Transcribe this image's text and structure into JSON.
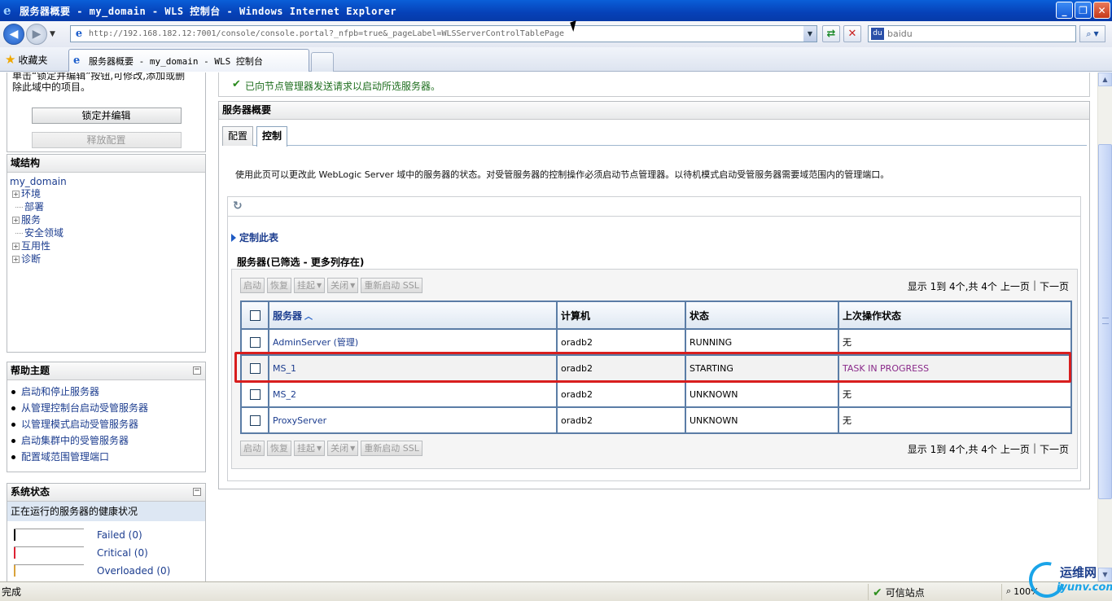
{
  "window": {
    "title": "服务器概要 - my_domain - WLS 控制台 - Windows Internet Explorer"
  },
  "address_bar": {
    "url": "http://192.168.182.12:7001/console/console.portal?_nfpb=true&_pageLabel=WLSServerControlTablePage"
  },
  "search": {
    "placeholder": "baidu"
  },
  "favorites": {
    "label": "收藏夹"
  },
  "tab": {
    "label": "服务器概要 - my_domain - WLS 控制台"
  },
  "change_center": {
    "text_line1": "单击“锁定并编辑”按钮,可修改,添加或删",
    "text_line2": "除此域中的项目。",
    "lock_button": "锁定并编辑",
    "release_button": "释放配置"
  },
  "domain_structure": {
    "title": "域结构",
    "root": "my_domain",
    "nodes": [
      {
        "label": "环境",
        "expandable": true
      },
      {
        "label": "部署",
        "expandable": false
      },
      {
        "label": "服务",
        "expandable": true
      },
      {
        "label": "安全领域",
        "expandable": false
      },
      {
        "label": "互用性",
        "expandable": true
      },
      {
        "label": "诊断",
        "expandable": true
      }
    ]
  },
  "help": {
    "title": "帮助主题",
    "items": [
      "启动和停止服务器",
      "从管理控制台启动受管服务器",
      "以管理模式启动受管服务器",
      "启动集群中的受管服务器",
      "配置域范围管理端口"
    ]
  },
  "system_status": {
    "title": "系统状态",
    "subtitle": "正在运行的服务器的健康状况",
    "rows": [
      {
        "label": "Failed (0)"
      },
      {
        "label": "Critical (0)"
      },
      {
        "label": "Overloaded (0)"
      }
    ]
  },
  "message": {
    "text": "已向节点管理器发送请求以启动所选服务器。"
  },
  "summary": {
    "title": "服务器概要",
    "tabs": [
      "配置",
      "控制"
    ],
    "active_tab": "控制",
    "description": "使用此页可以更改此 WebLogic Server 域中的服务器的状态。对受管服务器的控制操作必须启动节点管理器。以待机模式启动受管服务器需要域范围内的管理端口。",
    "customize_label": "定制此表",
    "table_title": "服务器(已筛选 - 更多列存在)"
  },
  "actions": {
    "start": "启动",
    "resume": "恢复",
    "suspend": "挂起",
    "shutdown": "关闭",
    "restart_ssl": "重新启动 SSL"
  },
  "pager": {
    "info": "显示 1到 4个,共 4个",
    "prev": "上一页",
    "next": "下一页"
  },
  "table": {
    "headers": [
      "服务器",
      "计算机",
      "状态",
      "上次操作状态"
    ],
    "rows": [
      {
        "server": "AdminServer (管理)",
        "machine": "oradb2",
        "state": "RUNNING",
        "last_status": "无"
      },
      {
        "server": "MS_1",
        "machine": "oradb2",
        "state": "STARTING",
        "last_status": "TASK IN PROGRESS"
      },
      {
        "server": "MS_2",
        "machine": "oradb2",
        "state": "UNKNOWN",
        "last_status": "无"
      },
      {
        "server": "ProxyServer",
        "machine": "oradb2",
        "state": "UNKNOWN",
        "last_status": "无"
      }
    ]
  },
  "statusbar": {
    "done": "完成",
    "zone": "可信站点",
    "zoom": "100%"
  },
  "watermark": {
    "line1": "运维网",
    "line2": "iyunv.com"
  }
}
